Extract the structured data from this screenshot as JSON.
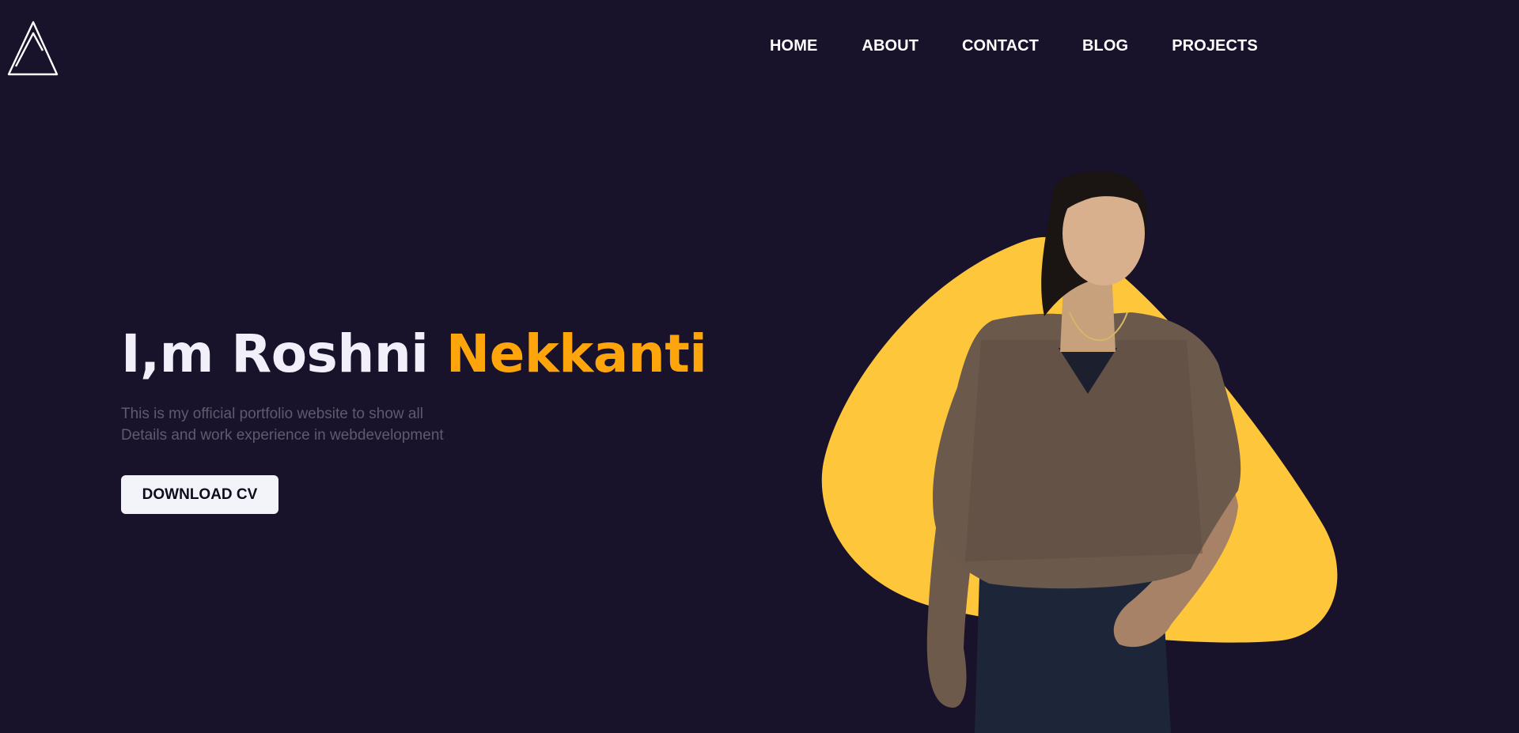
{
  "header": {
    "logo_icon": "triangle-logo-icon",
    "nav": [
      {
        "label": "HOME"
      },
      {
        "label": "ABOUT"
      },
      {
        "label": "CONTACT"
      },
      {
        "label": "BLOG"
      },
      {
        "label": "PROJECTS"
      }
    ]
  },
  "hero": {
    "greeting": "I,m Roshni",
    "surname": "Nekkanti",
    "description_line1": "This is my official portfolio website to show all",
    "description_line2": "Details and work experience in webdevelopment",
    "cta_label": "DOWNLOAD CV"
  },
  "colors": {
    "background": "#18122b",
    "accent": "#ffa50c",
    "blob": "#fec63a",
    "button_bg": "#f3f4f9",
    "muted_text": "#5f5a6d"
  }
}
